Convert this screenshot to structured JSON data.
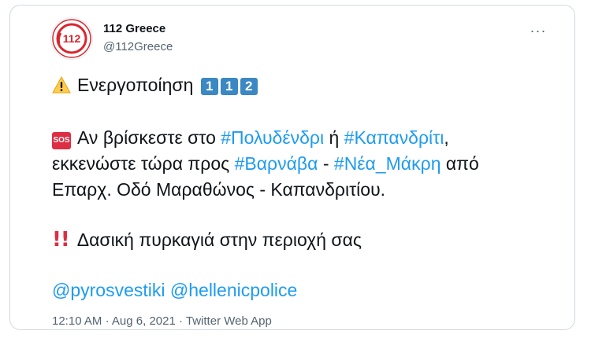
{
  "account": {
    "display_name": "112 Greece",
    "handle": "@112Greece",
    "avatar_text": "112"
  },
  "menu": {
    "more_label": "···"
  },
  "tweet": {
    "line1": {
      "emoji": "warning-icon",
      "text": "Ενεργοποίηση",
      "keys": [
        "1",
        "1",
        "2"
      ]
    },
    "line2": {
      "badge": "SOS",
      "prefix": "Αν βρίσκεστε στο",
      "tag1": "#Πολυδένδρι",
      "mid": "ή",
      "tag2": "#Καπανδρίτι",
      "suffix": ","
    },
    "line3": {
      "prefix": "εκκενώστε τώρα προς",
      "tag1": "#Βαρνάβα",
      "mid": "-",
      "tag2": "#Νέα_Μάκρη",
      "suffix": "από"
    },
    "line4": {
      "text": "Επαρχ. Οδό Μαραθώνος - Καπανδριτίου."
    },
    "line5": {
      "emoji": "double-exclamation-icon",
      "text": "Δασική πυρκαγιά στην περιοχή σας"
    },
    "mentions": [
      "@pyrosvestiki",
      "@hellenicpolice"
    ]
  },
  "meta": {
    "time": "12:10 AM",
    "date": "Aug 6, 2021",
    "client": "Twitter Web App",
    "separator": "·"
  },
  "colors": {
    "link": "#1d9bf0",
    "brand_red": "#d7262e",
    "keycap_blue": "#3b88c3",
    "sos_red": "#dd2e44"
  }
}
